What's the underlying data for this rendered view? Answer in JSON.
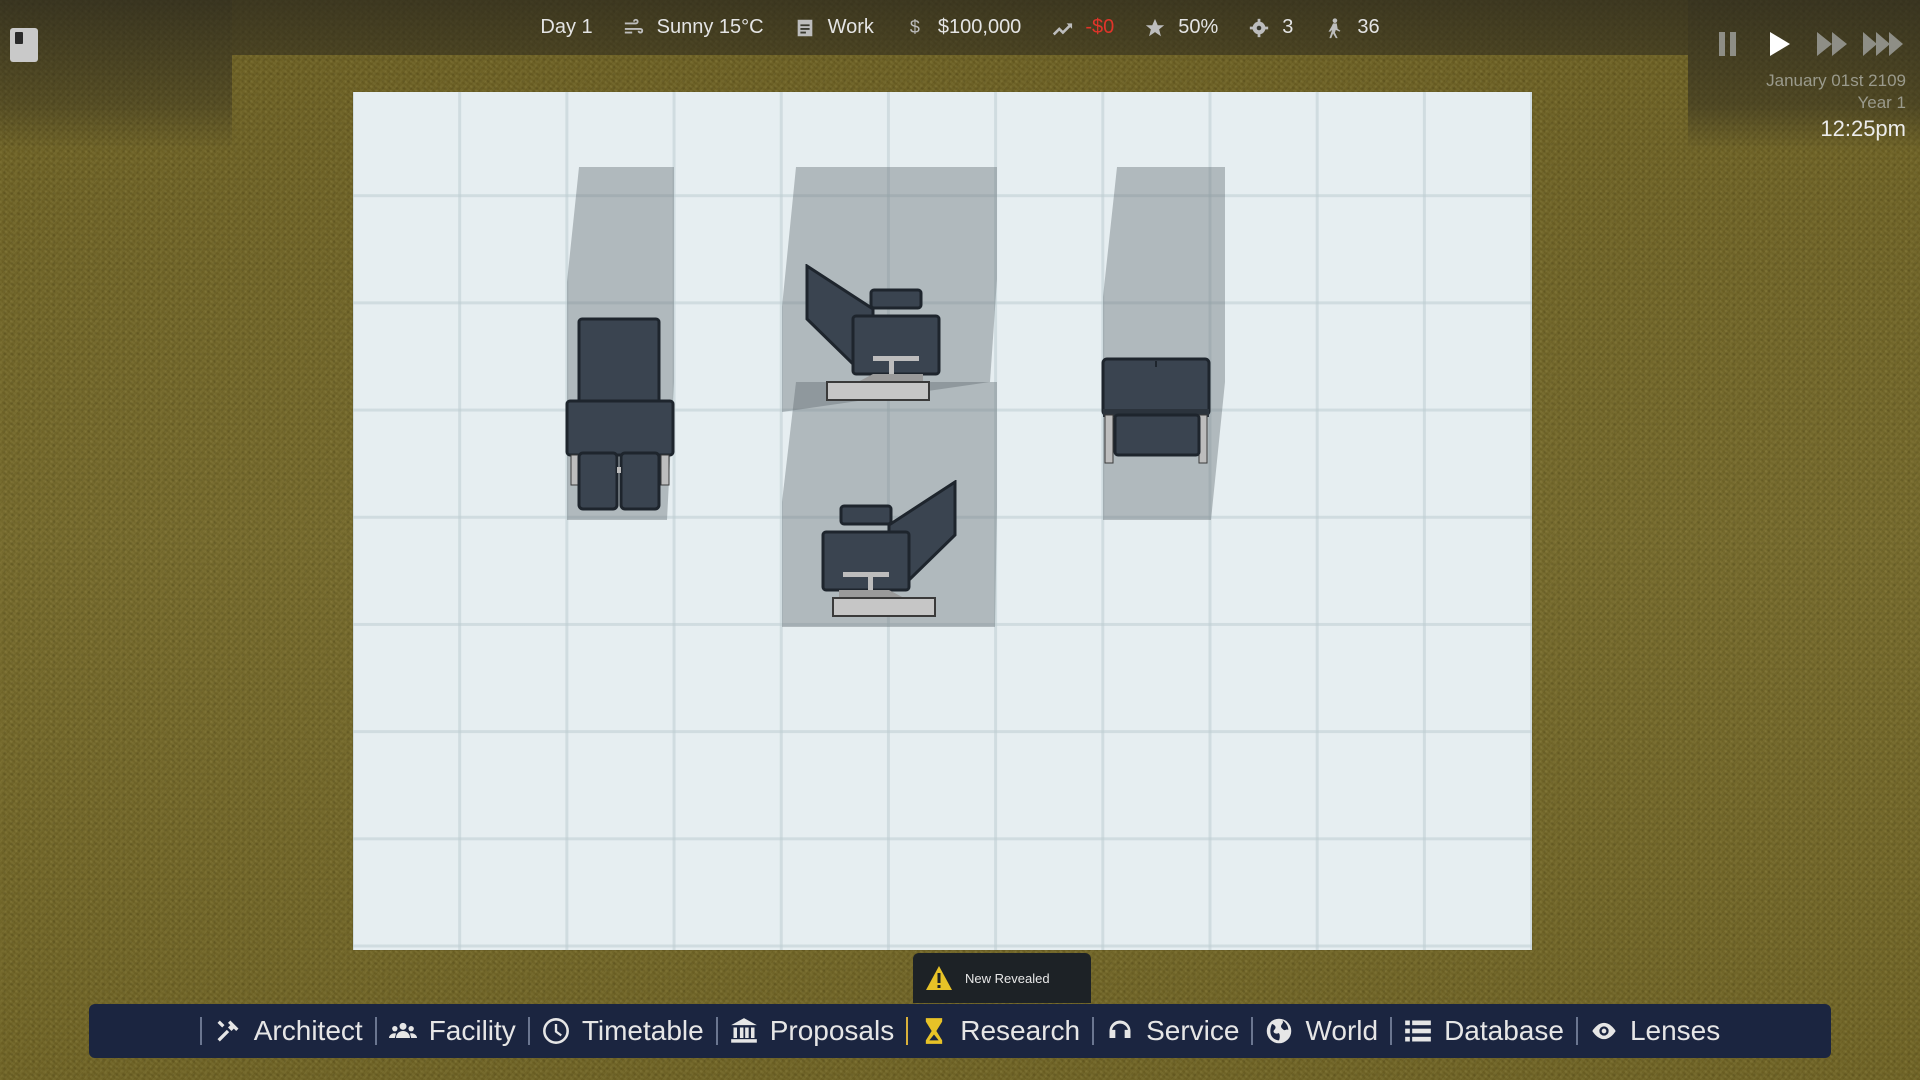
{
  "top_bar": {
    "day": "Day 1",
    "weather": "Sunny 15°C",
    "shift": "Work",
    "money": "$100,000",
    "money_change": "-$0",
    "rating": "50%",
    "staff_count": "3",
    "people_count": "36",
    "icons": {
      "weather": "wind-icon",
      "shift": "clipboard-icon",
      "money": "dollar-icon",
      "trend": "trend-up-icon",
      "rating": "star-icon",
      "staff": "gear-icon",
      "people": "walking-person-icon"
    }
  },
  "time": {
    "date": "January 01st 2109",
    "year": "Year 1",
    "clock": "12:25pm"
  },
  "speed_controls": [
    "pause",
    "play",
    "fast",
    "fastest"
  ],
  "notification": {
    "text": "New Revealed",
    "icon": "warning-icon"
  },
  "menu": {
    "architect": "Architect",
    "facility": "Facility",
    "timetable": "Timetable",
    "proposals": "Proposals",
    "research": "Research",
    "service": "Service",
    "world": "World",
    "database": "Database",
    "lenses": "Lenses"
  },
  "colors": {
    "accent_negative": "#e0342a",
    "menu_bg": "#1b2540",
    "research_separator": "#d9b13b",
    "furniture": "#3a4450"
  }
}
